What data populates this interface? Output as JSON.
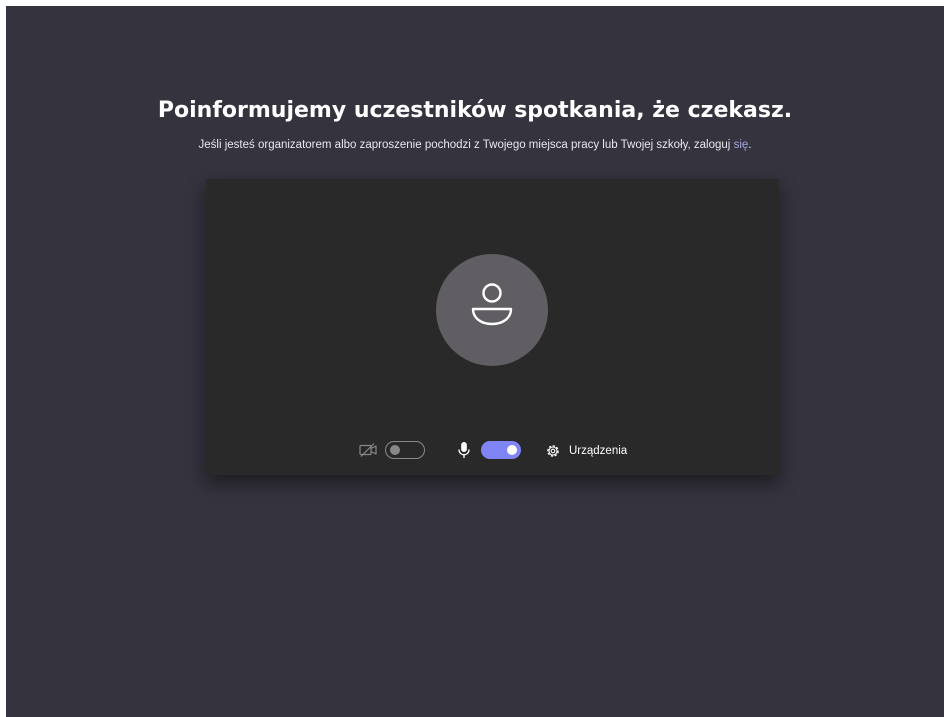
{
  "header": {
    "title": "Poinformujemy uczestników spotkania, że czekasz.",
    "subtitle_prefix": "Jeśli jesteś organizatorem albo zaproszenie pochodzi z Twojego miejsca pracy lub Twojej szkoły, zaloguj ",
    "signin_link": "się",
    "subtitle_suffix": "."
  },
  "preview": {
    "avatar_icon": "person-icon",
    "camera": {
      "icon": "camera-off-icon",
      "enabled": false
    },
    "microphone": {
      "icon": "microphone-icon",
      "enabled": true
    },
    "devices": {
      "icon": "gear-icon",
      "label": "Urządzenia"
    }
  },
  "colors": {
    "background": "#34333e",
    "preview_background": "#292929",
    "avatar": "#605e62",
    "accent": "#7f85f5",
    "link": "#a6a7dc"
  }
}
